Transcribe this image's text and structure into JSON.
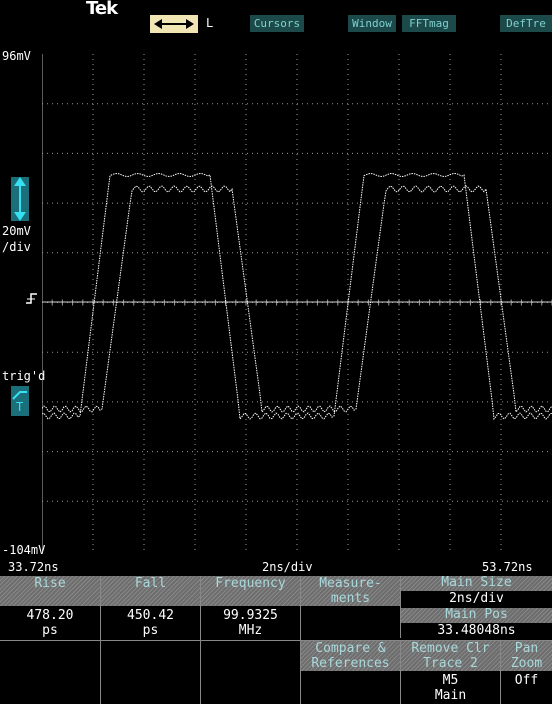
{
  "header": {
    "brand": "Tek",
    "hmode_suffix": "L",
    "menu": [
      "Cursors",
      "Window",
      "FFTmag",
      "DefTre"
    ]
  },
  "scale": {
    "top_voltage": "96mV",
    "bottom_voltage": "-104mV",
    "vdiv_value": "20mV",
    "vdiv_unit": "/div",
    "trig_label": "trig'd",
    "trig_marker": "T",
    "time_left": "33.72ns",
    "time_center": "2ns/div",
    "time_right": "53.72ns"
  },
  "measurements": [
    {
      "label": "Rise",
      "value": "478.20",
      "unit": "ps"
    },
    {
      "label": "Fall",
      "value": "450.42",
      "unit": "ps"
    },
    {
      "label": "Frequency",
      "value": "99.9325",
      "unit": "MHz"
    }
  ],
  "measure_button": "Measure-\nments",
  "side_menu": {
    "main_size_label": "Main Size",
    "main_size_value": "2ns/div",
    "main_pos_label": "Main Pos",
    "main_pos_value": "33.48048ns",
    "compare_label": "Compare &\nReferences",
    "remove_label": "Remove Clr\nTrace 2",
    "remove_value": "M5\nMain",
    "pan_label": "Pan\nZoom",
    "pan_value": "Off"
  },
  "colors": {
    "menu_text": "#7fd0d0",
    "menu_bg": "#1c4a4a",
    "header_bg": "#6d6d6d",
    "hmode_bg": "#f2e6b5",
    "trace": "#ffffff",
    "grid": "#b8b8b8"
  }
}
